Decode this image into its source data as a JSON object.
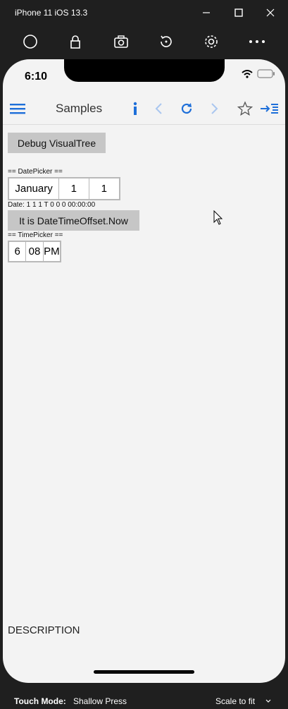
{
  "window": {
    "title": "iPhone 11 iOS 13.3"
  },
  "toolbar": {
    "icons": [
      "home-icon",
      "lock-icon",
      "screenshot-icon",
      "rotate-icon",
      "settings-icon",
      "more-icon"
    ]
  },
  "status": {
    "time": "6:10"
  },
  "navbar": {
    "title": "Samples"
  },
  "content": {
    "debug_button": "Debug VisualTree",
    "datepicker_header": "== DatePicker ==",
    "datepicker": {
      "month": "January",
      "day": "1",
      "year": "1"
    },
    "date_text": "Date: 1 1 1 T 0 0 0 00:00:00",
    "now_button": "It is DateTimeOffset.Now",
    "timepicker_header": "== TimePicker ==",
    "timepicker": {
      "hour": "6",
      "minute": "08",
      "ampm": "PM"
    },
    "description": "DESCRIPTION"
  },
  "bottom_bar": {
    "touch_mode_label": "Touch Mode:",
    "touch_mode_value": "Shallow Press",
    "scale_label": "Scale to fit"
  },
  "colors": {
    "accent": "#1e6fd9",
    "accent_disabled": "#a9c6ef"
  }
}
